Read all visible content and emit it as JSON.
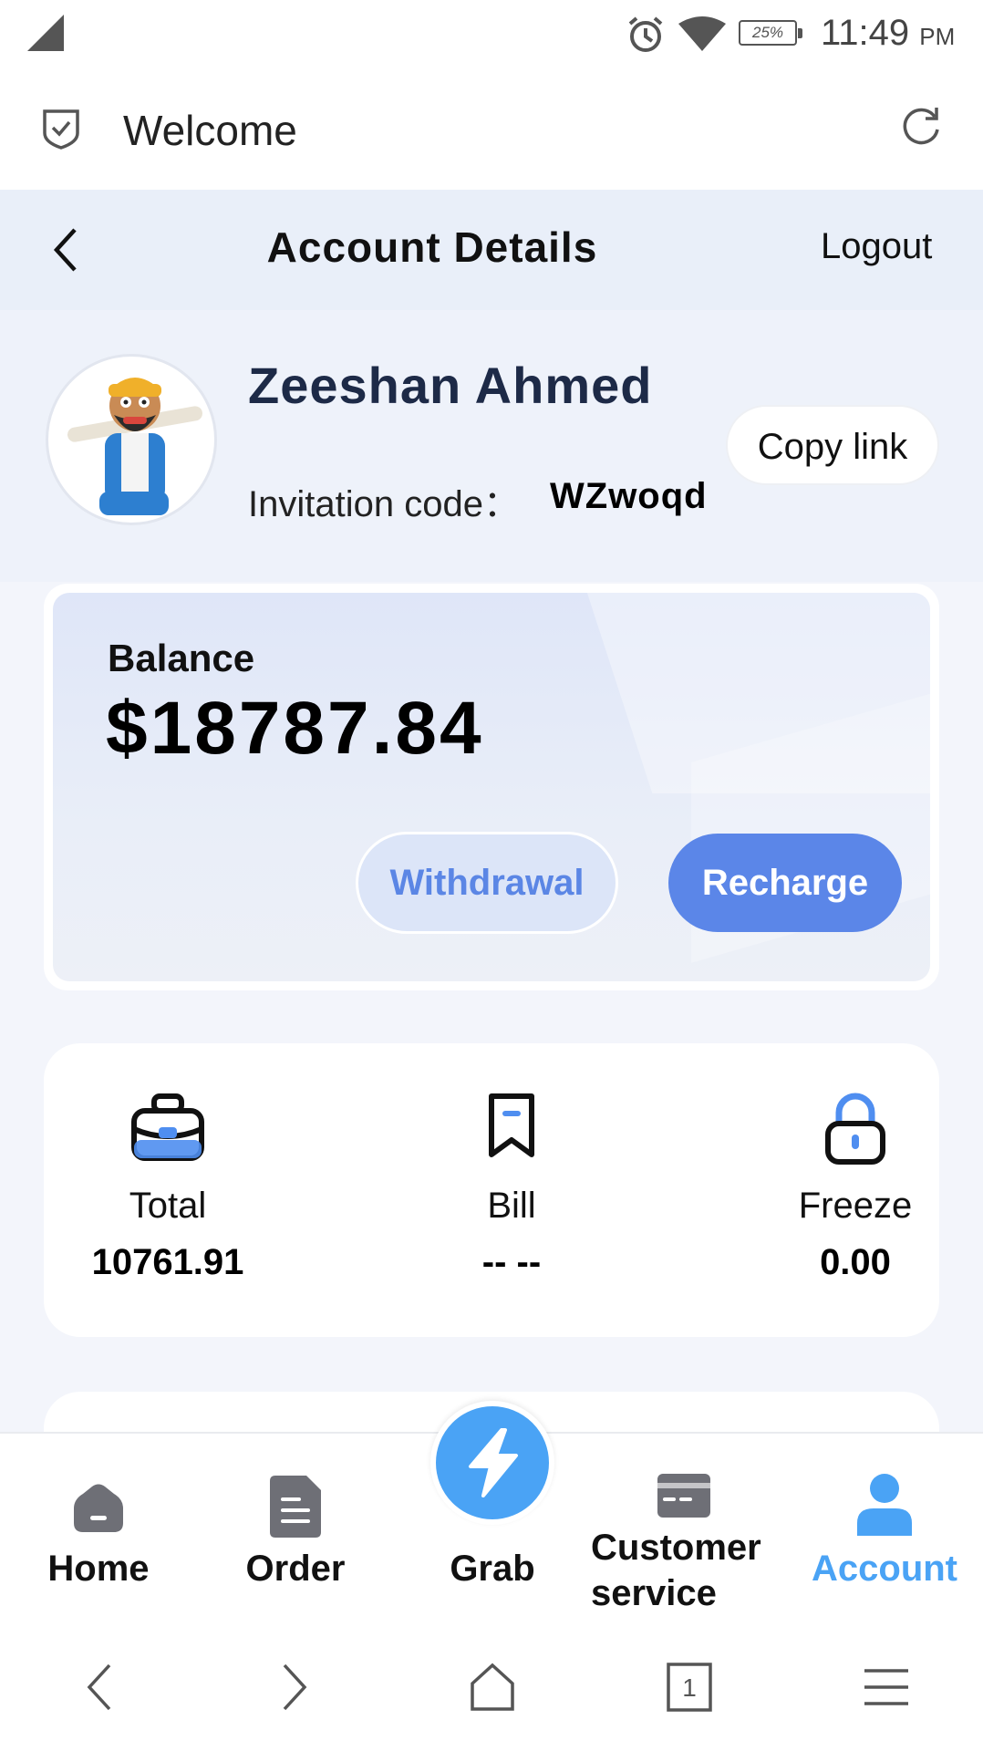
{
  "status_bar": {
    "battery": "25%",
    "time": "11:49",
    "ampm": "PM"
  },
  "browser": {
    "title": "Welcome"
  },
  "header": {
    "title": "Account Details",
    "logout_label": "Logout"
  },
  "profile": {
    "name": "Zeeshan Ahmed",
    "invitation_label": "Invitation code：",
    "invitation_code": "WZwoqd",
    "copy_link_label": "Copy link"
  },
  "balance": {
    "label": "Balance",
    "value": "$18787.84",
    "withdraw_label": "Withdrawal",
    "recharge_label": "Recharge"
  },
  "stats": [
    {
      "label": "Total",
      "value": "10761.91",
      "icon": "briefcase-icon"
    },
    {
      "label": "Bill",
      "value": "-- --",
      "icon": "bookmark-icon"
    },
    {
      "label": "Freeze",
      "value": "0.00",
      "icon": "lock-icon"
    }
  ],
  "tabs": [
    {
      "label": "Home",
      "icon": "home-icon"
    },
    {
      "label": "Order",
      "icon": "document-icon"
    },
    {
      "label": "Grab",
      "icon": "lightning-icon"
    },
    {
      "label": "Customer service",
      "icon": "card-icon"
    },
    {
      "label": "Account",
      "icon": "person-icon",
      "active": true
    }
  ],
  "colors": {
    "accent": "#5b86e8",
    "active_tab": "#4aa3f5",
    "header_bg": "#e9eff9",
    "name_color": "#1d2a47"
  }
}
